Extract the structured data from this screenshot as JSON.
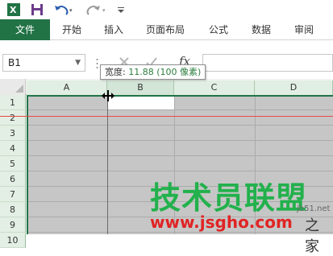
{
  "quick_access": {
    "excel_icon": "excel-logo-icon",
    "save_icon": "save-icon",
    "undo_icon": "undo-icon",
    "redo_icon": "redo-icon",
    "customize_icon": "customize-qat-icon"
  },
  "ribbon": {
    "file_tab": "文件",
    "tabs": [
      "开始",
      "插入",
      "页面布局",
      "公式",
      "数据",
      "审阅"
    ]
  },
  "formula_bar": {
    "name_box_value": "B1",
    "fx_label": "fx",
    "formula_value": ""
  },
  "sheet": {
    "columns": [
      "A",
      "B",
      "C",
      "D"
    ],
    "rows": [
      "1",
      "2",
      "3",
      "4",
      "5",
      "6",
      "7",
      "8",
      "9",
      "10"
    ],
    "selected_cell": "B1"
  },
  "tooltip": {
    "label": "宽度:",
    "value": "11.88 (100 像素)"
  },
  "watermark": {
    "title": "技术员联盟",
    "url": "www.jsgho.com",
    "corner_text": "jb51.net",
    "corner_text2": "之家"
  },
  "colors": {
    "accent": "#217346",
    "selection_gray": "#c6c6c6",
    "header_green": "#e1eee3",
    "guide_line": "#e84a4a",
    "watermark_green": "#22b14c",
    "watermark_red": "#e02424"
  }
}
